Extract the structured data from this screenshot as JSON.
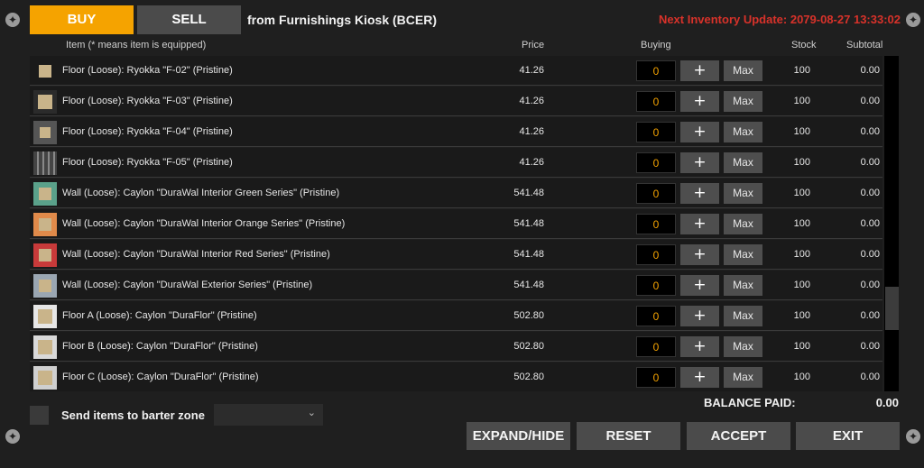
{
  "tabs": {
    "buy": "BUY",
    "sell": "SELL"
  },
  "kiosk_label": "from Furnishings Kiosk (BCER)",
  "inventory_update": "Next Inventory Update: 2079-08-27 13:33:02",
  "columns": {
    "item": "Item (* means item is equipped)",
    "price": "Price",
    "buying": "Buying",
    "stock": "Stock",
    "subtotal": "Subtotal"
  },
  "rows": [
    {
      "name": "Floor (Loose): Ryokka \"F-02\" (Pristine)",
      "price": "41.26",
      "qty": "0",
      "plus": "+",
      "max": "Max",
      "stock": "100",
      "subtotal": "0.00"
    },
    {
      "name": "Floor (Loose): Ryokka \"F-03\" (Pristine)",
      "price": "41.26",
      "qty": "0",
      "plus": "+",
      "max": "Max",
      "stock": "100",
      "subtotal": "0.00"
    },
    {
      "name": "Floor (Loose): Ryokka \"F-04\" (Pristine)",
      "price": "41.26",
      "qty": "0",
      "plus": "+",
      "max": "Max",
      "stock": "100",
      "subtotal": "0.00"
    },
    {
      "name": "Floor (Loose): Ryokka \"F-05\" (Pristine)",
      "price": "41.26",
      "qty": "0",
      "plus": "+",
      "max": "Max",
      "stock": "100",
      "subtotal": "0.00"
    },
    {
      "name": "Wall (Loose): Caylon \"DuraWal Interior Green Series\" (Pristine)",
      "price": "541.48",
      "qty": "0",
      "plus": "+",
      "max": "Max",
      "stock": "100",
      "subtotal": "0.00"
    },
    {
      "name": "Wall (Loose): Caylon \"DuraWal Interior Orange Series\" (Pristine)",
      "price": "541.48",
      "qty": "0",
      "plus": "+",
      "max": "Max",
      "stock": "100",
      "subtotal": "0.00"
    },
    {
      "name": "Wall (Loose): Caylon \"DuraWal Interior Red Series\" (Pristine)",
      "price": "541.48",
      "qty": "0",
      "plus": "+",
      "max": "Max",
      "stock": "100",
      "subtotal": "0.00"
    },
    {
      "name": "Wall (Loose): Caylon \"DuraWal Exterior Series\" (Pristine)",
      "price": "541.48",
      "qty": "0",
      "plus": "+",
      "max": "Max",
      "stock": "100",
      "subtotal": "0.00"
    },
    {
      "name": "Floor A (Loose): Caylon \"DuraFlor\" (Pristine)",
      "price": "502.80",
      "qty": "0",
      "plus": "+",
      "max": "Max",
      "stock": "100",
      "subtotal": "0.00"
    },
    {
      "name": "Floor B (Loose): Caylon \"DuraFlor\" (Pristine)",
      "price": "502.80",
      "qty": "0",
      "plus": "+",
      "max": "Max",
      "stock": "100",
      "subtotal": "0.00"
    },
    {
      "name": "Floor C (Loose): Caylon \"DuraFlor\" (Pristine)",
      "price": "502.80",
      "qty": "0",
      "plus": "+",
      "max": "Max",
      "stock": "100",
      "subtotal": "0.00"
    }
  ],
  "barter_label": "Send items to barter zone",
  "balance_label": "BALANCE PAID:",
  "balance_value": "0.00",
  "buttons": {
    "expand": "EXPAND/HIDE",
    "reset": "RESET",
    "accept": "ACCEPT",
    "exit": "EXIT"
  },
  "colors": {
    "accent": "#f5a300",
    "alert": "#d8322a"
  }
}
